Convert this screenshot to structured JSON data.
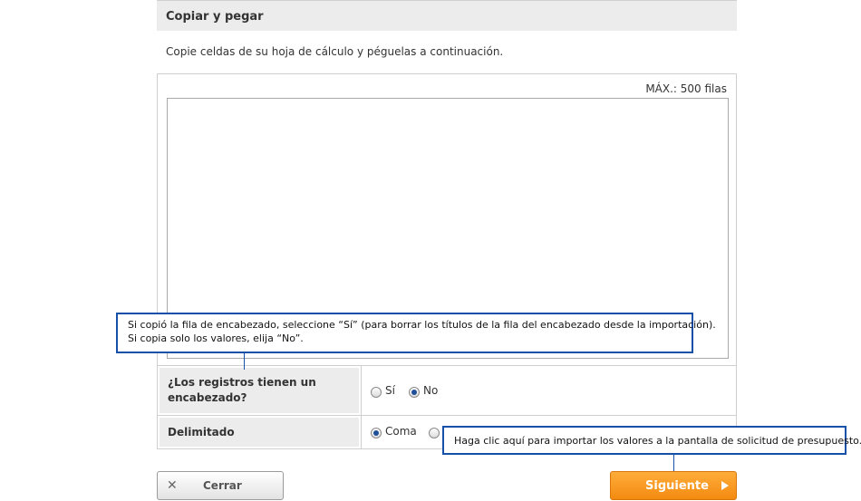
{
  "section": {
    "title": "Copiar y pegar",
    "instruction": "Copie celdas de su hoja de cálculo y péguelas a continuación.",
    "max_rows": "MÁX.: 500 filas",
    "paste_value": ""
  },
  "options": {
    "header_question": "¿Los registros tienen un encabezado?",
    "header_yes": "Sí",
    "header_no": "No",
    "header_selected": "No",
    "delimiter_label": "Delimitado",
    "delimiter_comma": "Coma",
    "delimiter_selected": "Coma"
  },
  "callouts": {
    "header_hint_line1": "Si copió la fila de encabezado, seleccione “Sí” (para borrar los títulos de la fila del encabezado desde la importación).",
    "header_hint_line2": "Si copia solo los valores, elija “No”.",
    "next_hint": "Haga clic aquí para importar los valores a la pantalla de solicitud de presupuesto."
  },
  "buttons": {
    "close_label": "Cerrar",
    "next_label": "Siguiente"
  },
  "colors": {
    "accent_orange": "#f38a10",
    "callout_blue": "#1650a8"
  }
}
